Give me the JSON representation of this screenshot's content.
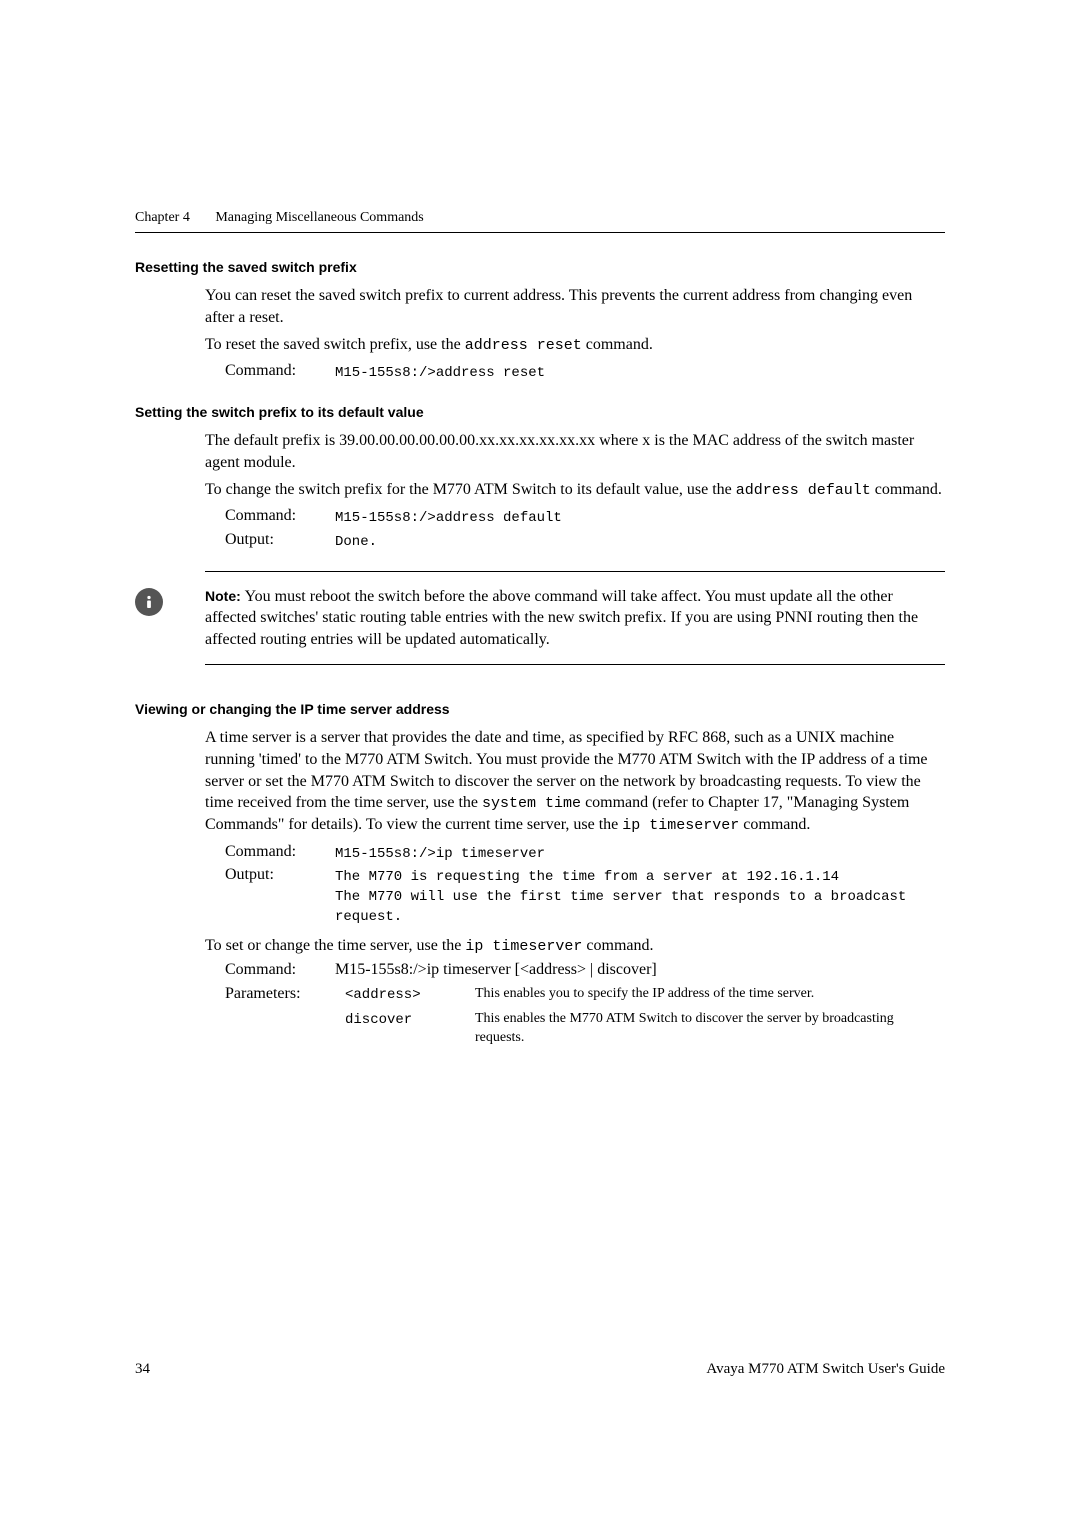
{
  "chapter": {
    "label": "Chapter 4",
    "title": "Managing Miscellaneous Commands"
  },
  "sec1": {
    "heading": "Resetting the saved switch prefix",
    "p1": "You can reset the saved switch prefix to current address. This prevents the current address from changing even after a reset.",
    "p2_pre": "To reset the saved switch prefix, use the ",
    "p2_code": "address reset",
    "p2_post": " command.",
    "cmd_label": "Command:",
    "cmd_val": "M15-155s8:/>address reset"
  },
  "sec2": {
    "heading": "Setting the switch prefix to its default value",
    "p1": "The default prefix is 39.00.00.00.00.00.00.xx.xx.xx.xx.xx.xx where x is the MAC address of the switch master agent module.",
    "p2_pre": "To change the switch prefix for the M770 ATM Switch to its default value, use the ",
    "p2_code": "address default",
    "p2_post": " command.",
    "cmd_label": "Command:",
    "cmd_val": "M15-155s8:/>address default",
    "out_label": "Output:",
    "out_val": "Done."
  },
  "note": {
    "prefix": "Note: ",
    "body": " You must reboot the switch before the above command will take affect. You must update all the other affected switches' static routing table entries with the new switch prefix. If you are using PNNI routing then the affected routing entries will be updated automatically."
  },
  "sec3": {
    "heading": "Viewing or changing the IP time server address",
    "p1_a": "A time server is a server that provides the date and time, as specified by RFC 868, such as a UNIX machine running 'timed' to the M770 ATM Switch. You must provide the M770 ATM Switch with the IP address of a time server or set the M770 ATM Switch to discover the server on the network by broadcasting requests. To view the time received from the time server, use the ",
    "p1_code1": "system time",
    "p1_b": " command (refer to Chapter 17, \"Managing System Commands\" for details). To view the current time server, use the ",
    "p1_code2": "ip timeserver",
    "p1_c": " command.",
    "cmd_label": "Command:",
    "cmd_val": "M15-155s8:/>ip timeserver",
    "out_label": "Output:",
    "out_val": "The M770 is requesting the time from a server at 192.16.1.14\nThe M770 will use the first time server that responds to a broadcast request.",
    "set_pre": "To set or change the time server, use the ",
    "set_code": "ip timeserver",
    "set_post": " command.",
    "cmd2_label": "Command:",
    "cmd2_val": "M15-155s8:/>ip timeserver [<address> | discover]",
    "param_label": "Parameters:",
    "param1_code": "<address>",
    "param1_desc": "This enables you to specify the IP address of the time server.",
    "param2_code": "discover",
    "param2_desc": "This enables the M770 ATM Switch to discover the server by broadcasting requests."
  },
  "footer": {
    "page": "34",
    "guide": "Avaya M770 ATM Switch User's Guide"
  }
}
